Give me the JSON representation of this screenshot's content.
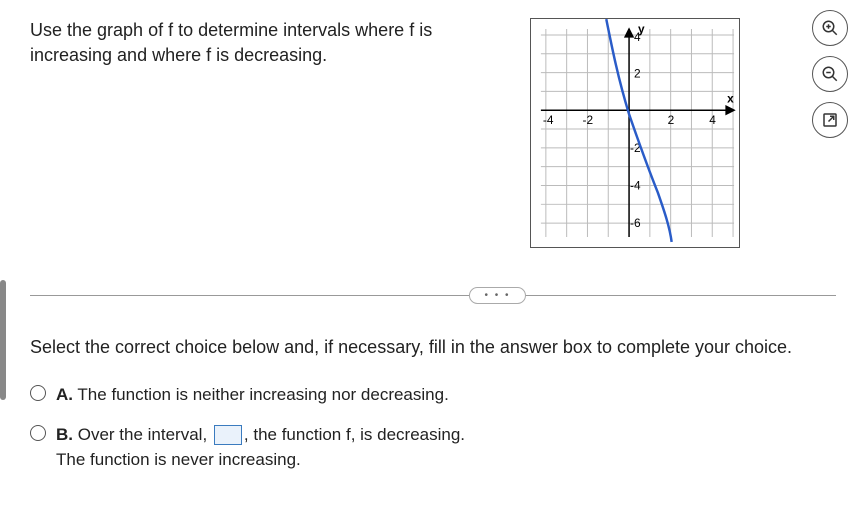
{
  "question": "Use the graph of f to determine intervals where f is increasing and where f is decreasing.",
  "instruction": "Select the correct choice below and, if necessary, fill in the answer box to complete your choice.",
  "divider_dots": "• • •",
  "graph": {
    "x_label": "x",
    "y_label": "y",
    "x_ticks": [
      -4,
      -2,
      2,
      4
    ],
    "y_ticks": [
      4,
      2,
      -2,
      -4,
      -6
    ]
  },
  "toolbar": {
    "zoom_in": "zoom-in",
    "zoom_out": "zoom-out",
    "popout": "popout"
  },
  "choices": {
    "a": {
      "letter": "A.",
      "text": "The function is neither increasing nor decreasing."
    },
    "b": {
      "letter": "B.",
      "text_before": "Over the interval, ",
      "text_after": ", the function f, is decreasing.",
      "line2": "The function is never increasing."
    }
  },
  "chart_data": {
    "type": "line",
    "title": "",
    "xlabel": "x",
    "ylabel": "y",
    "xlim": [
      -5,
      5
    ],
    "ylim": [
      -7,
      5
    ],
    "x_ticks": [
      -4,
      -2,
      0,
      2,
      4
    ],
    "y_ticks": [
      -6,
      -4,
      -2,
      0,
      2,
      4
    ],
    "series": [
      {
        "name": "f",
        "x": [
          -1.2,
          -1.0,
          -0.8,
          -0.5,
          0.0,
          0.3,
          0.5,
          0.8,
          1.0,
          1.3,
          1.6,
          1.8,
          2.0,
          2.1,
          2.2
        ],
        "values": [
          5.0,
          4.0,
          2.5,
          1.0,
          -0.2,
          -0.8,
          -1.2,
          -2.0,
          -3.0,
          -4.1,
          -5.2,
          -6.0,
          -6.6,
          -6.9,
          -7.0
        ]
      }
    ]
  }
}
